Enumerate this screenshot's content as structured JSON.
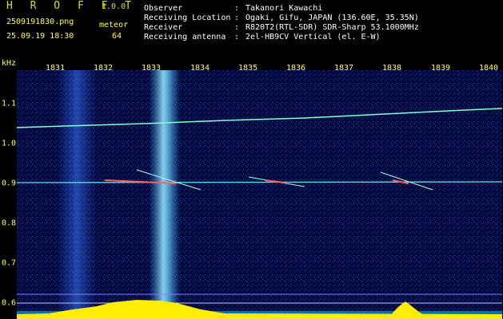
{
  "header": {
    "app_name": "H R O F F T",
    "version": "1.0.0",
    "filename": "2509191830.png",
    "timestamp": "25.09.19 18:30",
    "category_label": "meteor",
    "count": "64",
    "meta": [
      {
        "key": "Observer",
        "value": "Takanori Kawachi"
      },
      {
        "key": "Receiving Location",
        "value": "Ogaki, Gifu, JAPAN (136.60E, 35.35N)"
      },
      {
        "key": "Receiver",
        "value": "R820T2(RTL-SDR) SDR-Sharp 53.1000MHz"
      },
      {
        "key": "Receiving antenna",
        "value": "2el-HB9CV Vertical (el. E-W)"
      }
    ]
  },
  "axes": {
    "y_unit": "kHz",
    "x_ticks": [
      "1831",
      "1832",
      "1833",
      "1834",
      "1835",
      "1836",
      "1837",
      "1838",
      "1839",
      "1840"
    ],
    "y_ticks": [
      "1.1",
      "1.0",
      "0.9",
      "0.8",
      "0.7",
      "0.6"
    ]
  },
  "colors": {
    "label_yellow": "#ffff44",
    "background_noise": "#02062a",
    "signal_cyan": "#7fffd0",
    "meteor_red": "#ff6060"
  }
}
